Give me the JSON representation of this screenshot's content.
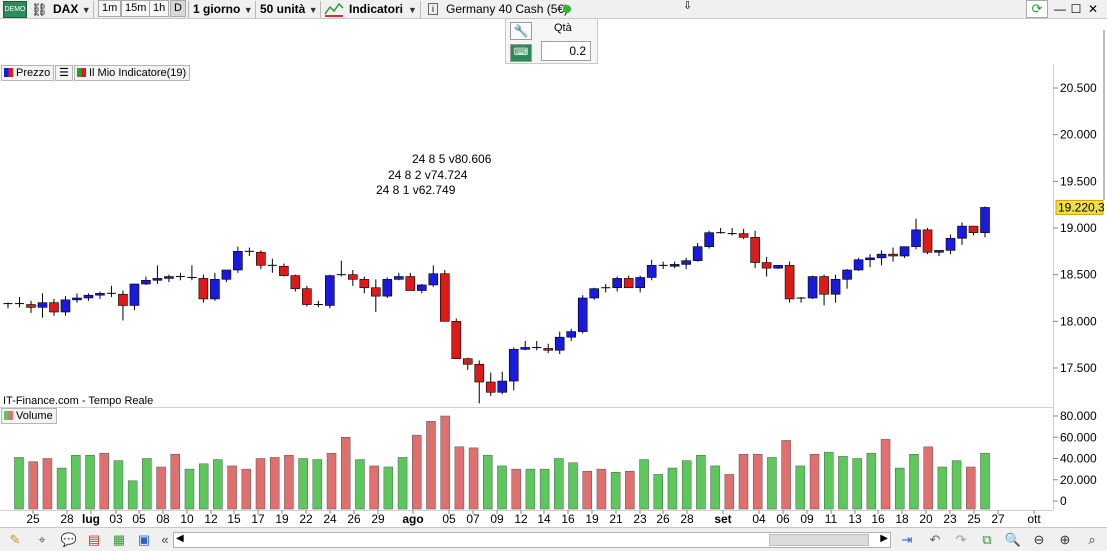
{
  "toolbar": {
    "ticker": "DAX",
    "tf_1m": "1m",
    "tf_15m": "15m",
    "tf_1h": "1h",
    "tf_d": "D",
    "period": "1 giorno",
    "units": "50 unità",
    "indicators": "Indicatori",
    "instrument": "Germany 40 Cash (5€)"
  },
  "order_panel": {
    "qty_label": "Qtà",
    "qty_value": "0.2"
  },
  "legend": {
    "price": "Prezzo",
    "indicator": "Il Mio Indicatore(19)",
    "volume": "Volume"
  },
  "source_label": "IT-Finance.com - Tempo Reale",
  "annotations": [
    "24 8 5 v80.606",
    "24 8 2 v74.724",
    "24 8 1 v62.749"
  ],
  "colors": {
    "up": "#1a1adc",
    "down": "#dc1a1a",
    "volume": "#5cc85c",
    "volume_down": "#e07070",
    "price_tag": "#f2dc4c"
  },
  "icons": [
    "search-icon",
    "zoom-in-icon",
    "zoom-out-icon",
    "undo-icon",
    "redo-icon",
    "refresh-icon"
  ],
  "chart_data": [
    {
      "type": "candlestick",
      "title": "Germany 40 Cash (5€)",
      "y_ticks": [
        "20.500",
        "20.000",
        "19.500",
        "19.000",
        "18.500",
        "18.000",
        "17.500"
      ],
      "ylim": [
        17400,
        20700
      ],
      "last_price_label": "19.220,3",
      "last_price": 19220.3,
      "x_ticks": [
        "25",
        "28",
        "lug",
        "03",
        "05",
        "08",
        "10",
        "12",
        "15",
        "17",
        "19",
        "22",
        "24",
        "26",
        "29",
        "ago",
        "05",
        "07",
        "09",
        "12",
        "14",
        "16",
        "19",
        "21",
        "23",
        "26",
        "28",
        "set",
        "04",
        "06",
        "09",
        "11",
        "13",
        "16",
        "18",
        "20",
        "23",
        "25",
        "27",
        "ott"
      ],
      "candles": [
        [
          18180,
          18200,
          18140,
          18190
        ],
        [
          18190,
          18260,
          18150,
          18180
        ],
        [
          18180,
          18220,
          18090,
          18150
        ],
        [
          18150,
          18300,
          18040,
          18200
        ],
        [
          18200,
          18240,
          18060,
          18100
        ],
        [
          18100,
          18270,
          18060,
          18230
        ],
        [
          18230,
          18300,
          18200,
          18250
        ],
        [
          18250,
          18300,
          18220,
          18280
        ],
        [
          18280,
          18320,
          18240,
          18300
        ],
        [
          18300,
          18380,
          18260,
          18290
        ],
        [
          18290,
          18330,
          18010,
          18170
        ],
        [
          18170,
          18400,
          18120,
          18400
        ],
        [
          18400,
          18480,
          18390,
          18440
        ],
        [
          18440,
          18600,
          18400,
          18460
        ],
        [
          18460,
          18500,
          18420,
          18480
        ],
        [
          18480,
          18520,
          18440,
          18470
        ],
        [
          18470,
          18600,
          18440,
          18460
        ],
        [
          18460,
          18500,
          18200,
          18240
        ],
        [
          18240,
          18520,
          18220,
          18450
        ],
        [
          18450,
          18540,
          18420,
          18550
        ],
        [
          18550,
          18800,
          18520,
          18750
        ],
        [
          18750,
          18790,
          18700,
          18740
        ],
        [
          18740,
          18760,
          18560,
          18600
        ],
        [
          18600,
          18670,
          18520,
          18590
        ],
        [
          18590,
          18620,
          18480,
          18490
        ],
        [
          18490,
          18500,
          18320,
          18350
        ],
        [
          18350,
          18380,
          18160,
          18180
        ],
        [
          18180,
          18220,
          18150,
          18170
        ],
        [
          18170,
          18500,
          18140,
          18490
        ],
        [
          18490,
          18650,
          18480,
          18500
        ],
        [
          18500,
          18550,
          18380,
          18450
        ],
        [
          18450,
          18480,
          18300,
          18360
        ],
        [
          18360,
          18450,
          18100,
          18270
        ],
        [
          18270,
          18470,
          18250,
          18450
        ],
        [
          18450,
          18520,
          18440,
          18480
        ],
        [
          18480,
          18520,
          18360,
          18330
        ],
        [
          18330,
          18400,
          18300,
          18390
        ],
        [
          18390,
          18600,
          18370,
          18510
        ],
        [
          18510,
          18550,
          18300,
          18000
        ],
        [
          18000,
          18030,
          17600,
          17600
        ],
        [
          17600,
          17610,
          17480,
          17540
        ],
        [
          17540,
          17580,
          17120,
          17350
        ],
        [
          17350,
          17450,
          17200,
          17240
        ],
        [
          17240,
          17460,
          17220,
          17360
        ],
        [
          17360,
          17720,
          17260,
          17700
        ],
        [
          17700,
          17790,
          17690,
          17720
        ],
        [
          17720,
          17790,
          17690,
          17710
        ],
        [
          17710,
          17760,
          17660,
          17690
        ],
        [
          17690,
          17890,
          17650,
          17830
        ],
        [
          17830,
          17920,
          17790,
          17890
        ],
        [
          17890,
          18280,
          17870,
          18250
        ],
        [
          18250,
          18360,
          18230,
          18350
        ],
        [
          18350,
          18400,
          18310,
          18360
        ],
        [
          18360,
          18480,
          18320,
          18460
        ],
        [
          18460,
          18490,
          18360,
          18360
        ],
        [
          18360,
          18490,
          18310,
          18470
        ],
        [
          18470,
          18660,
          18440,
          18600
        ],
        [
          18600,
          18640,
          18560,
          18590
        ],
        [
          18590,
          18640,
          18570,
          18610
        ],
        [
          18610,
          18680,
          18560,
          18650
        ],
        [
          18650,
          18840,
          18640,
          18800
        ],
        [
          18800,
          18970,
          18780,
          18950
        ],
        [
          18950,
          19000,
          18940,
          18940
        ],
        [
          18940,
          19000,
          18920,
          18940
        ],
        [
          18940,
          18990,
          18880,
          18900
        ],
        [
          18900,
          18970,
          18570,
          18630
        ],
        [
          18630,
          18690,
          18480,
          18570
        ],
        [
          18570,
          18600,
          18560,
          18600
        ],
        [
          18600,
          18640,
          18200,
          18240
        ],
        [
          18240,
          18260,
          18200,
          18250
        ],
        [
          18250,
          18490,
          18240,
          18480
        ],
        [
          18480,
          18500,
          18170,
          18290
        ],
        [
          18290,
          18500,
          18200,
          18450
        ],
        [
          18450,
          18560,
          18350,
          18550
        ],
        [
          18550,
          18680,
          18540,
          18660
        ],
        [
          18660,
          18720,
          18580,
          18680
        ],
        [
          18680,
          18760,
          18600,
          18720
        ],
        [
          18720,
          18790,
          18640,
          18700
        ],
        [
          18700,
          18800,
          18680,
          18800
        ],
        [
          18800,
          19100,
          18770,
          18980
        ],
        [
          18980,
          19000,
          18720,
          18740
        ],
        [
          18740,
          18760,
          18700,
          18760
        ],
        [
          18760,
          18930,
          18720,
          18890
        ],
        [
          18890,
          19060,
          18820,
          19020
        ],
        [
          19020,
          19020,
          18920,
          18950
        ],
        [
          18950,
          19230,
          18900,
          19220
        ]
      ]
    },
    {
      "type": "bar",
      "title": "Volume",
      "y_ticks": [
        "80.000",
        "60.000",
        "40.000",
        "20.000",
        "0"
      ],
      "ylim": [
        0,
        85000
      ],
      "values": [
        41000,
        37000,
        40000,
        31000,
        43000,
        43000,
        45000,
        38000,
        19000,
        40000,
        32000,
        44000,
        30000,
        35000,
        39000,
        33000,
        30000,
        40000,
        41000,
        43000,
        40000,
        39000,
        45000,
        60000,
        39000,
        33000,
        32000,
        41000,
        62000,
        75000,
        80000,
        51000,
        50000,
        43000,
        33000,
        30000,
        30000,
        30000,
        40000,
        36000,
        28000,
        30000,
        27000,
        28000,
        39000,
        25000,
        31000,
        38000,
        43000,
        33000,
        25000,
        44000,
        44000,
        41000,
        57000,
        33000,
        44000,
        46000,
        42000,
        40000,
        45000,
        58000,
        31000,
        44000,
        51000,
        32000,
        38000,
        32000,
        45000
      ],
      "down": [
        false,
        true,
        true,
        false,
        false,
        false,
        true,
        false,
        false,
        false,
        true,
        true,
        false,
        false,
        false,
        true,
        true,
        true,
        true,
        true,
        false,
        false,
        true,
        true,
        false,
        true,
        false,
        false,
        true,
        true,
        true,
        true,
        true,
        false,
        false,
        true,
        false,
        false,
        false,
        false,
        true,
        true,
        false,
        true,
        false,
        false,
        false,
        false,
        false,
        false,
        true,
        true,
        true,
        false,
        true,
        false,
        true,
        false,
        false,
        false,
        false,
        true,
        false,
        false,
        true,
        false,
        false,
        true,
        false
      ]
    }
  ]
}
